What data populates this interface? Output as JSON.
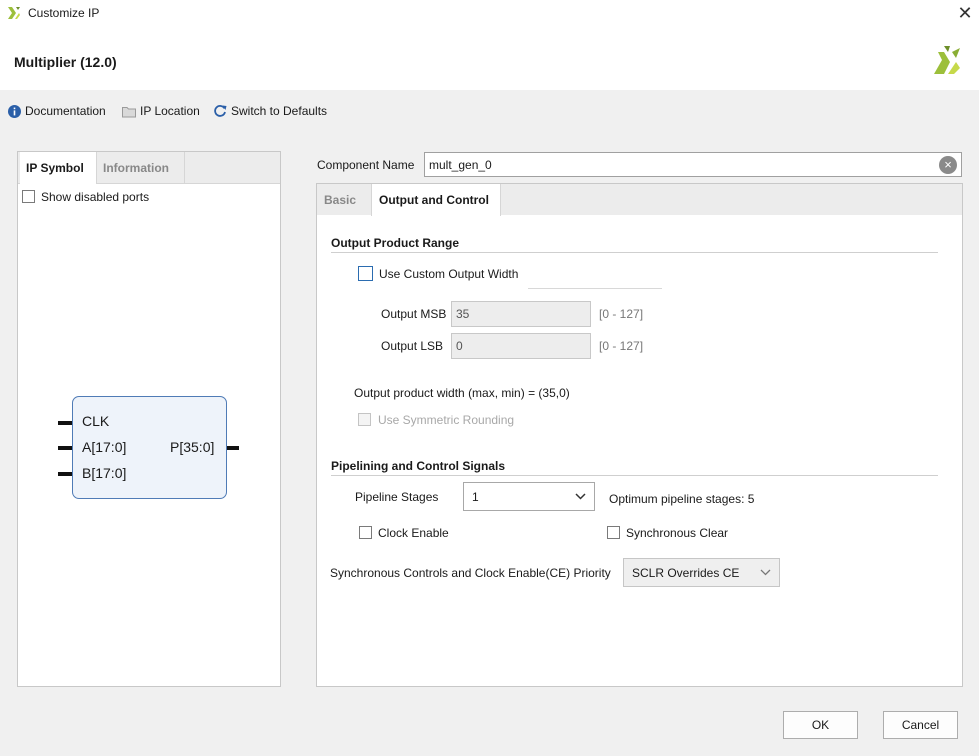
{
  "window": {
    "title": "Customize IP",
    "close_glyph": "✕"
  },
  "header": {
    "title": "Multiplier (12.0)"
  },
  "toolbar": {
    "documentation": "Documentation",
    "ip_location": "IP Location",
    "switch_defaults": "Switch to Defaults"
  },
  "left_panel": {
    "tabs": [
      {
        "label": "IP Symbol",
        "active": true
      },
      {
        "label": "Information",
        "active": false
      }
    ],
    "show_disabled_ports": {
      "label": "Show disabled ports",
      "checked": false
    },
    "symbol": {
      "ports_left": [
        "CLK",
        "A[17:0]",
        "B[17:0]"
      ],
      "ports_right": [
        "P[35:0]"
      ]
    }
  },
  "component_name": {
    "label": "Component Name",
    "value": "mult_gen_0",
    "clear_glyph": "×"
  },
  "right_panel": {
    "tabs": [
      {
        "label": "Basic",
        "active": false
      },
      {
        "label": "Output and Control",
        "active": true
      }
    ],
    "output_product_range": {
      "title": "Output Product Range",
      "use_custom_width": {
        "label": "Use Custom Output Width",
        "checked": false
      },
      "output_msb": {
        "label": "Output MSB",
        "value": "35",
        "range": "[0 - 127]"
      },
      "output_lsb": {
        "label": "Output LSB",
        "value": "0",
        "range": "[0 - 127]"
      },
      "width_text": "Output product width (max, min) = (35,0)",
      "symmetric_rounding": {
        "label": "Use Symmetric Rounding",
        "checked": false,
        "enabled": false
      }
    },
    "pipelining": {
      "title": "Pipelining and Control Signals",
      "pipeline_stages": {
        "label": "Pipeline Stages",
        "value": "1"
      },
      "optimum_text": "Optimum pipeline stages: 5",
      "clock_enable": {
        "label": "Clock Enable",
        "checked": false
      },
      "sync_clear": {
        "label": "Synchronous Clear",
        "checked": false
      },
      "priority": {
        "label": "Synchronous Controls and Clock Enable(CE) Priority",
        "value": "SCLR Overrides CE"
      }
    }
  },
  "buttons": {
    "ok": "OK",
    "cancel": "Cancel"
  },
  "colors": {
    "accent_blue": "#2b6cb0",
    "brand_green": "#9cbf3b",
    "symbol_border": "#4f7bb6"
  }
}
